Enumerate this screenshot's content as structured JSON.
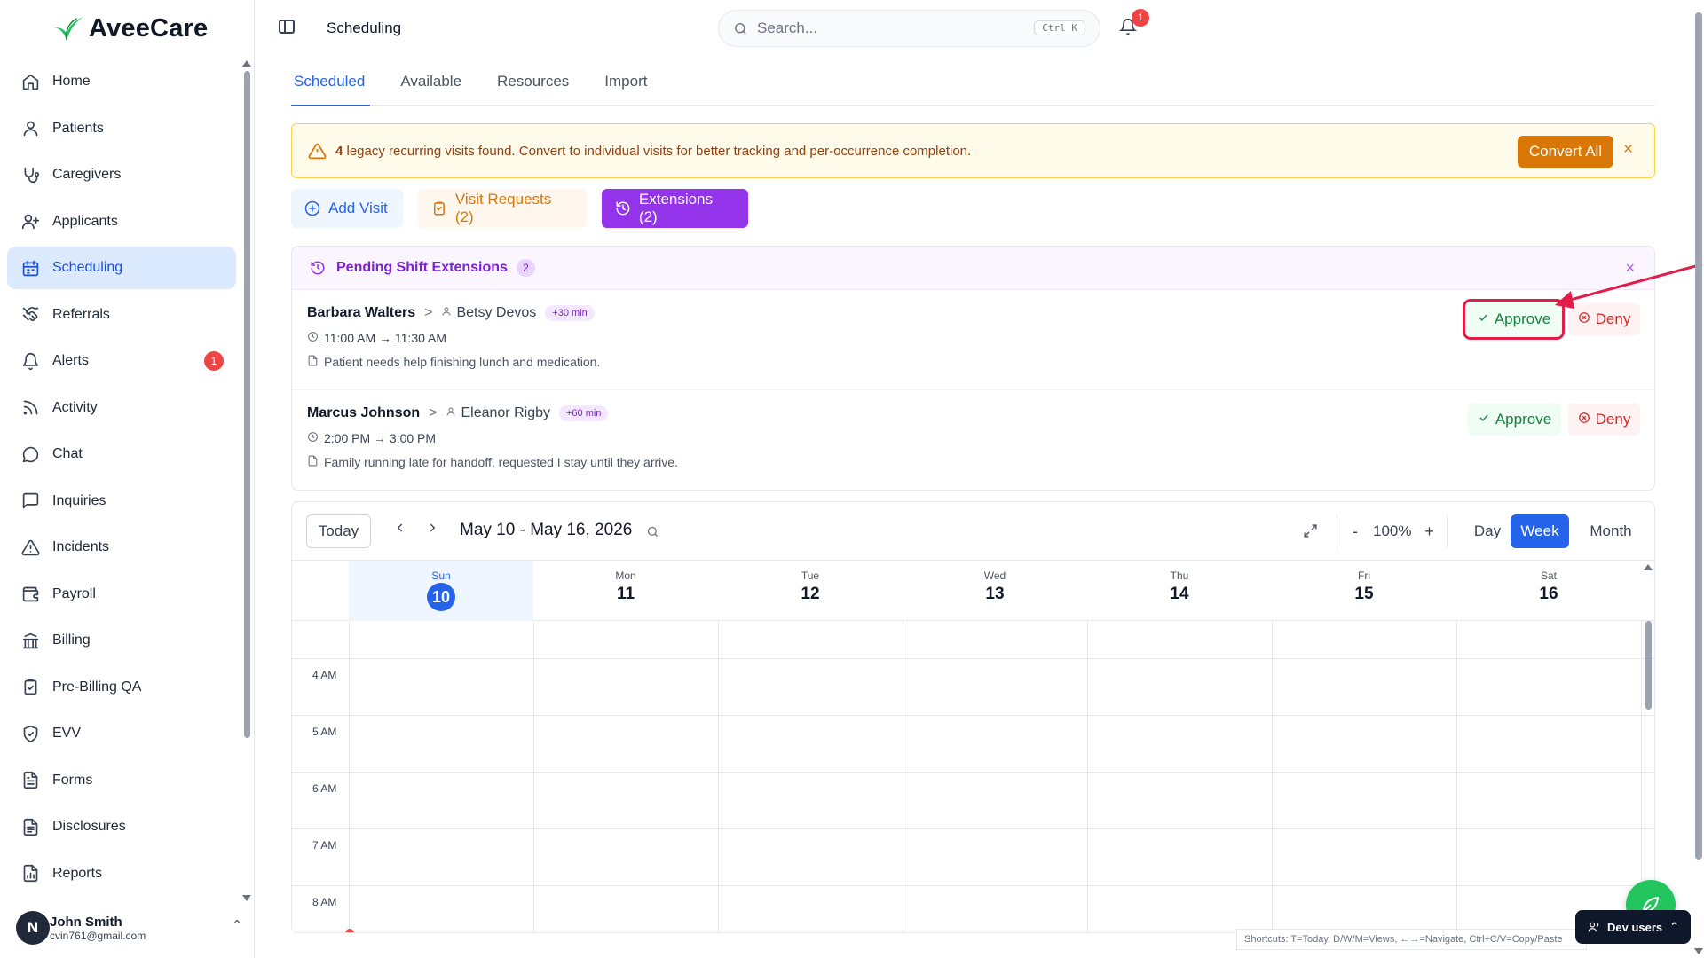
{
  "app": {
    "name": "AveeCare"
  },
  "sidebar": {
    "items": [
      {
        "label": "Home",
        "icon": "home-icon",
        "name": "home",
        "active": false
      },
      {
        "label": "Patients",
        "icon": "user-icon",
        "name": "patients",
        "active": false
      },
      {
        "label": "Caregivers",
        "icon": "stethoscope-icon",
        "name": "caregivers",
        "active": false
      },
      {
        "label": "Applicants",
        "icon": "user-plus-icon",
        "name": "applicants",
        "active": false
      },
      {
        "label": "Scheduling",
        "icon": "calendar-icon",
        "name": "scheduling",
        "active": true
      },
      {
        "label": "Referrals",
        "icon": "handshake-icon",
        "name": "referrals",
        "active": false
      },
      {
        "label": "Alerts",
        "icon": "bell-icon",
        "name": "alerts",
        "active": false,
        "badge": "1"
      },
      {
        "label": "Activity",
        "icon": "rss-icon",
        "name": "activity",
        "active": false
      },
      {
        "label": "Chat",
        "icon": "chat-icon",
        "name": "chat",
        "active": false
      },
      {
        "label": "Inquiries",
        "icon": "message-square-icon",
        "name": "inquiries",
        "active": false
      },
      {
        "label": "Incidents",
        "icon": "warning-icon",
        "name": "incidents",
        "active": false
      },
      {
        "label": "Payroll",
        "icon": "wallet-icon",
        "name": "payroll",
        "active": false
      },
      {
        "label": "Billing",
        "icon": "bank-icon",
        "name": "billing",
        "active": false
      },
      {
        "label": "Pre-Billing QA",
        "icon": "clipboard-check-icon",
        "name": "pre-billing-qa",
        "active": false
      },
      {
        "label": "EVV",
        "icon": "shield-check-icon",
        "name": "evv",
        "active": false
      },
      {
        "label": "Forms",
        "icon": "file-text-icon",
        "name": "forms",
        "active": false
      },
      {
        "label": "Disclosures",
        "icon": "file-lines-icon",
        "name": "disclosures",
        "active": false
      },
      {
        "label": "Reports",
        "icon": "file-chart-icon",
        "name": "reports",
        "active": false
      }
    ],
    "user": {
      "initial": "N",
      "name": "John Smith",
      "email": "cvin761@gmail.com"
    }
  },
  "topbar": {
    "page_title": "Scheduling",
    "search_placeholder": "Search...",
    "search_shortcut": "Ctrl K",
    "notification_count": "1"
  },
  "tabs": [
    {
      "label": "Scheduled",
      "active": true
    },
    {
      "label": "Available",
      "active": false
    },
    {
      "label": "Resources",
      "active": false
    },
    {
      "label": "Import",
      "active": false
    }
  ],
  "banner": {
    "count": "4",
    "message": " legacy recurring visits found. Convert to individual visits for better tracking and per-occurrence completion.",
    "action_label": "Convert All",
    "close": "×"
  },
  "actions": {
    "add_visit": "Add Visit",
    "visit_requests": "Visit Requests (2)",
    "extensions": "Extensions (2)"
  },
  "pending": {
    "title": "Pending Shift Extensions",
    "count": "2",
    "close": "×",
    "approve_label": "Approve",
    "deny_label": "Deny",
    "separator": ">",
    "items": [
      {
        "patient": "Barbara Walters",
        "caregiver": "Betsy Devos",
        "extra": "+30 min",
        "time": "11:00 AM → 11:30 AM",
        "note": "Patient needs help finishing lunch and medication."
      },
      {
        "patient": "Marcus Johnson",
        "caregiver": "Eleanor Rigby",
        "extra": "+60 min",
        "time": "2:00 PM → 3:00 PM",
        "note": "Family running late for handoff, requested I stay until they arrive."
      }
    ]
  },
  "calendar": {
    "today_label": "Today",
    "range": "May 10 - May 16, 2026",
    "zoom": "100%",
    "zoom_minus": "-",
    "zoom_plus": "+",
    "views": [
      "Day",
      "Week",
      "Month"
    ],
    "active_view": "Week",
    "days": [
      {
        "name": "Sun",
        "num": "10",
        "today": true
      },
      {
        "name": "Mon",
        "num": "11",
        "today": false
      },
      {
        "name": "Tue",
        "num": "12",
        "today": false
      },
      {
        "name": "Wed",
        "num": "13",
        "today": false
      },
      {
        "name": "Thu",
        "num": "14",
        "today": false
      },
      {
        "name": "Fri",
        "num": "15",
        "today": false
      },
      {
        "name": "Sat",
        "num": "16",
        "today": false
      }
    ],
    "hours": [
      "4 AM",
      "5 AM",
      "6 AM",
      "7 AM",
      "8 AM"
    ]
  },
  "footer": {
    "shortcuts": "Shortcuts: T=Today, D/W/M=Views, ←→=Navigate, Ctrl+C/V=Copy/Paste",
    "dev_users": "Dev users"
  },
  "colors": {
    "primary": "#2563eb",
    "purple": "#9333ea",
    "amber": "#d97706",
    "success": "#15803d",
    "danger": "#dc2626",
    "annotation": "#e11d48"
  }
}
